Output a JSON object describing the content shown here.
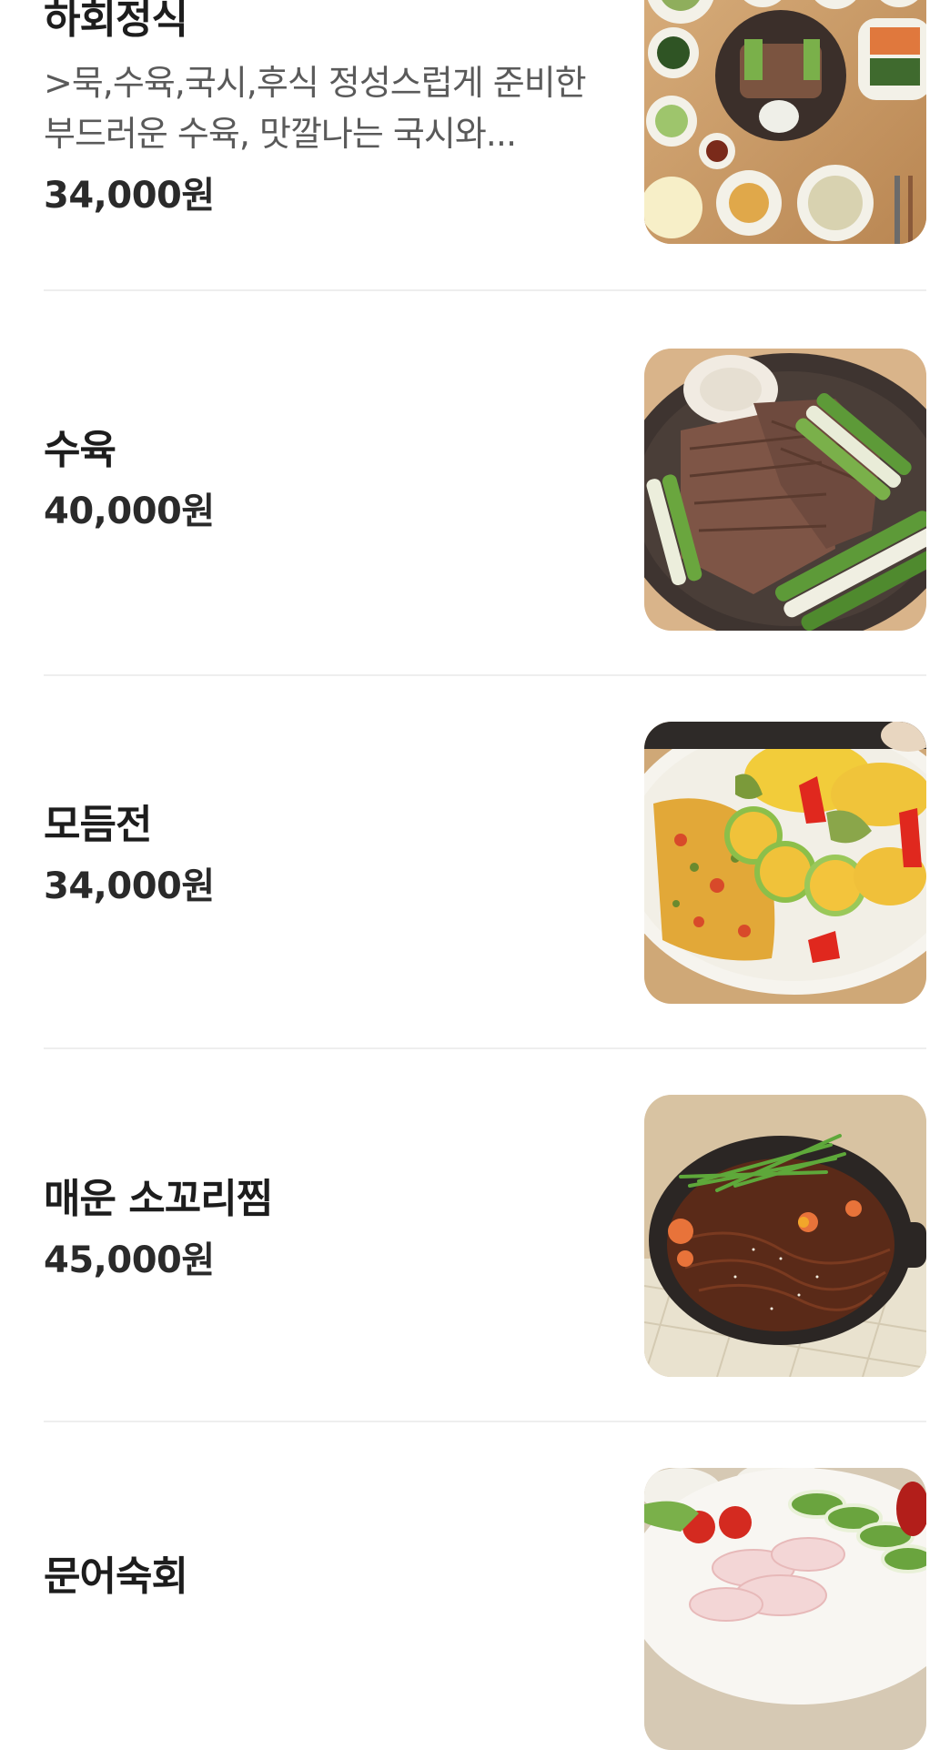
{
  "menu": {
    "items": [
      {
        "name": "하회정식",
        "description": ">묵,수육,국시,후식 정성스럽게 준비한 부드러운 수육, 맛깔나는 국시와...",
        "price": "34,000원",
        "image": "korean-set-meal-photo"
      },
      {
        "name": "수육",
        "description": "",
        "price": "40,000원",
        "image": "boiled-pork-slices-photo"
      },
      {
        "name": "모듬전",
        "description": "",
        "price": "34,000원",
        "image": "assorted-pancakes-photo"
      },
      {
        "name": "매운 소꼬리찜",
        "description": "",
        "price": "45,000원",
        "image": "spicy-braised-oxtail-photo"
      },
      {
        "name": "문어숙회",
        "description": "",
        "price": "",
        "image": "boiled-octopus-photo"
      }
    ]
  },
  "colors": {
    "divider": "#eeeeee",
    "name_text": "#1d1d1d",
    "desc_text": "#5a5a5a",
    "price_text": "#2a2a2a"
  }
}
